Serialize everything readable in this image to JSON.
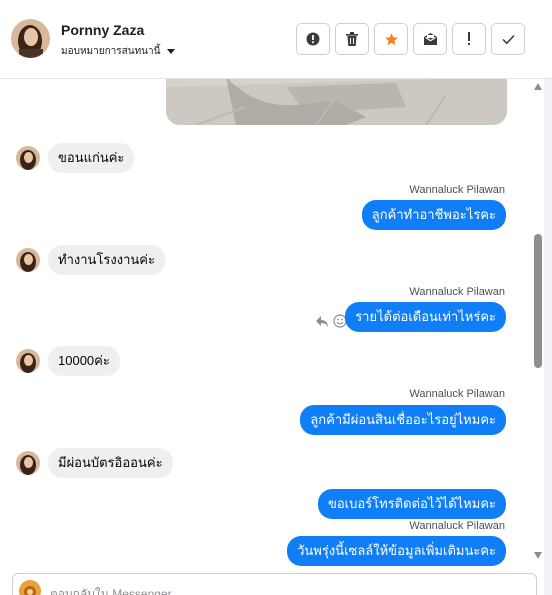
{
  "header": {
    "contact_name": "Pornny Zaza",
    "assign_label": "มอบหมายการสนทนานี้",
    "actions": [
      {
        "icon": "alert-circle-icon"
      },
      {
        "icon": "trash-icon"
      },
      {
        "icon": "star-icon",
        "color": "#f5821f"
      },
      {
        "icon": "envelope-icon"
      },
      {
        "icon": "exclamation-icon"
      },
      {
        "icon": "checkmark-icon"
      }
    ]
  },
  "conversation": {
    "messages": [
      {
        "direction": "in",
        "text": "ขอนแก่นค่ะ"
      },
      {
        "direction": "out",
        "sender": "Wannaluck Pilawan",
        "text": "ลูกค้าทำอาชีพอะไรคะ"
      },
      {
        "direction": "in",
        "text": "ทำงานโรงงานค่ะ"
      },
      {
        "direction": "out",
        "sender": "Wannaluck Pilawan",
        "text": "รายได้ต่อเดือนเท่าไหร่คะ"
      },
      {
        "direction": "in",
        "text": "10000ค่ะ"
      },
      {
        "direction": "out",
        "sender": "Wannaluck Pilawan",
        "text": "ลูกค้ามีผ่อนสินเชื่ออะไรอยู่ไหมคะ"
      },
      {
        "direction": "in",
        "text": "มีผ่อนบัตรอิออนค่ะ"
      },
      {
        "direction": "out",
        "text": "ขอเบอร์โทรติดต่อไว้ได้ไหมคะ"
      },
      {
        "direction": "out",
        "sender": "Wannaluck Pilawan",
        "text": "วันพรุ่งนี้เซลล์ให้ข้อมูลเพิ่มเติมนะคะ"
      }
    ]
  },
  "composer": {
    "placeholder": "ตอบกลับใน Messenger..."
  },
  "colors": {
    "outgoing_bubble": "#0f7ef7",
    "incoming_bubble": "#efefef",
    "star": "#f5821f"
  }
}
